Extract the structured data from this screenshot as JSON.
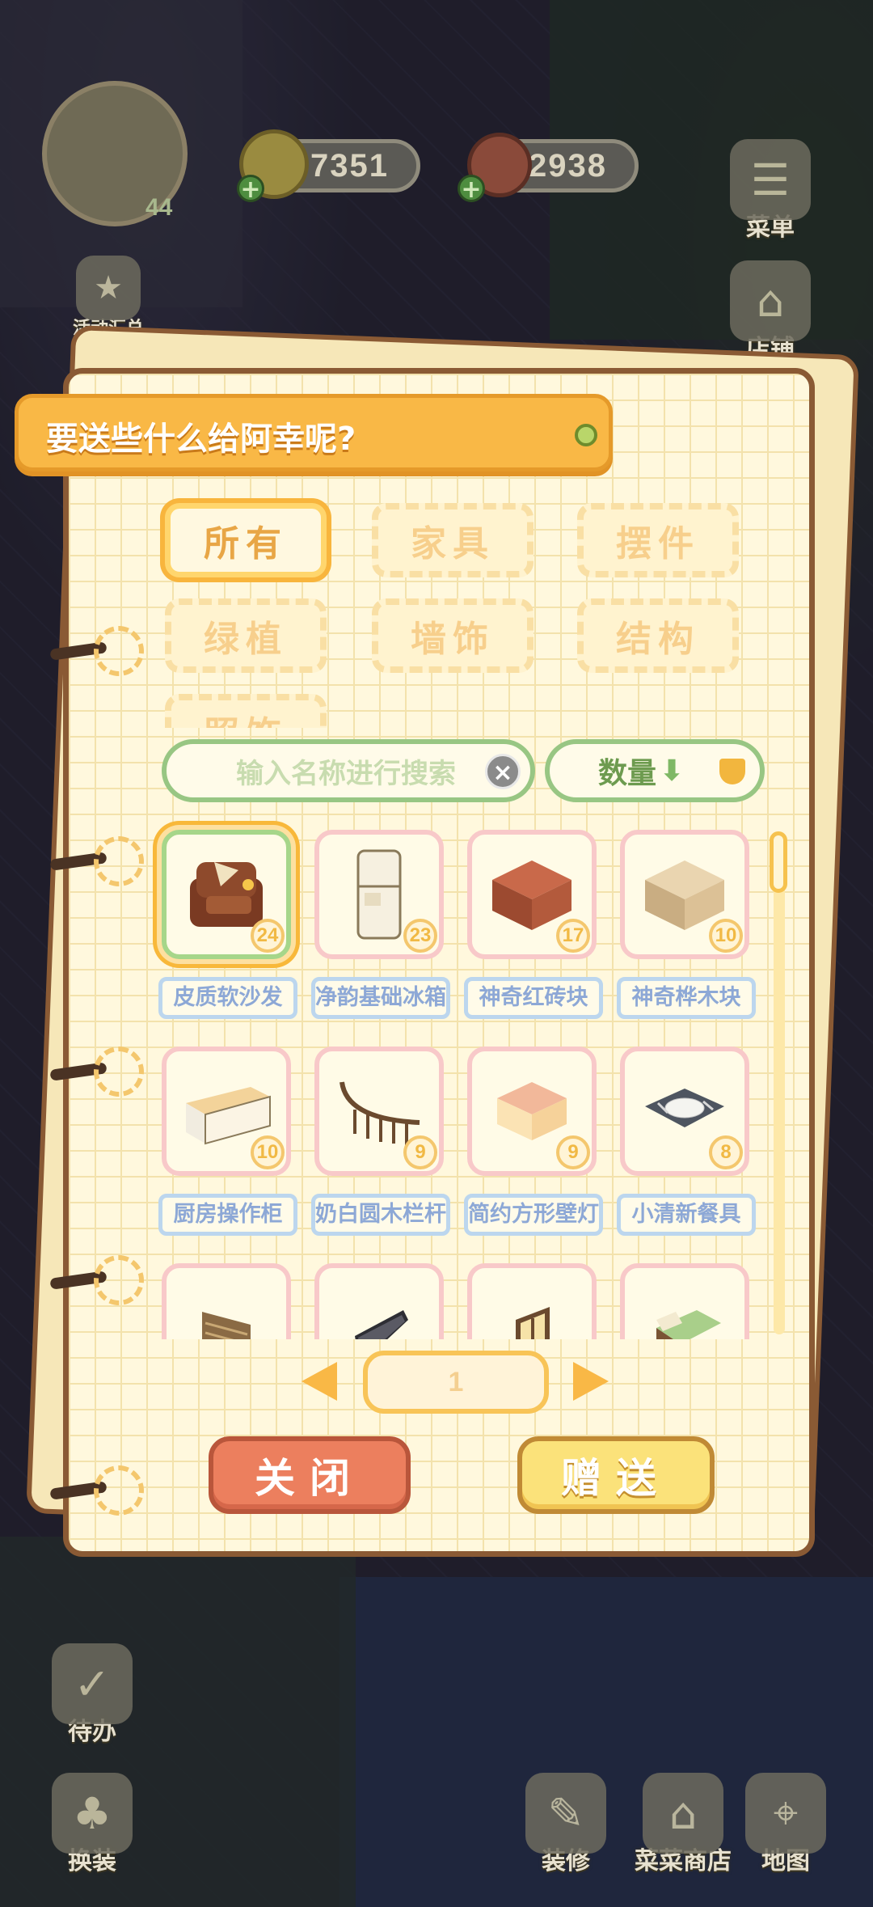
{
  "hud": {
    "level": "44",
    "coins": "7351",
    "hearts": "2938",
    "events_label": "活动汇总",
    "menu_label": "菜单",
    "shop_label": "店铺",
    "todo_label": "待办",
    "dress_label": "换装",
    "decorate_label": "装修",
    "veg_shop_label": "菜菜商店",
    "map_label": "地图"
  },
  "dialog": {
    "title": "要送些什么给阿幸呢?",
    "tabs": [
      {
        "label": "所有",
        "active": true
      },
      {
        "label": "家具",
        "active": false
      },
      {
        "label": "摆件",
        "active": false
      },
      {
        "label": "绿植",
        "active": false
      },
      {
        "label": "墙饰",
        "active": false
      },
      {
        "label": "结构",
        "active": false
      },
      {
        "label": "照饰",
        "active": false
      }
    ],
    "search_placeholder": "输入名称进行搜索",
    "clear_icon": "×",
    "sort_label": "数量",
    "sort_arrow": "⬇",
    "items": [
      {
        "name": "皮质软沙发",
        "count": "24",
        "icon": "sofa-icon",
        "selected": true
      },
      {
        "name": "净韵基础冰箱",
        "count": "23",
        "icon": "fridge-icon",
        "selected": false
      },
      {
        "name": "神奇红砖块",
        "count": "17",
        "icon": "red-brick-icon",
        "selected": false
      },
      {
        "name": "神奇桦木块",
        "count": "10",
        "icon": "birch-block-icon",
        "selected": false
      },
      {
        "name": "厨房操作柜",
        "count": "10",
        "icon": "kitchen-cabinet-icon",
        "selected": false
      },
      {
        "name": "奶白圆木栏杆",
        "count": "9",
        "icon": "railing-icon",
        "selected": false
      },
      {
        "name": "简约方形壁灯",
        "count": "9",
        "icon": "wall-lamp-icon",
        "selected": false
      },
      {
        "name": "小清新餐具",
        "count": "8",
        "icon": "tableware-icon",
        "selected": false
      },
      {
        "name": "",
        "count": "",
        "icon": "shutter-icon",
        "selected": false
      },
      {
        "name": "",
        "count": "",
        "icon": "tv-icon",
        "selected": false
      },
      {
        "name": "",
        "count": "",
        "icon": "window-icon",
        "selected": false
      },
      {
        "name": "",
        "count": "",
        "icon": "bed-icon",
        "selected": false
      }
    ],
    "page": "1",
    "close_label": "关闭",
    "send_label": "赠送"
  },
  "colors": {
    "banner": "#f9b846",
    "close_button": "#ec7f5e",
    "send_button": "#fbe27a",
    "tab_active_border": "#f8b53d",
    "search_border": "#98c683"
  }
}
